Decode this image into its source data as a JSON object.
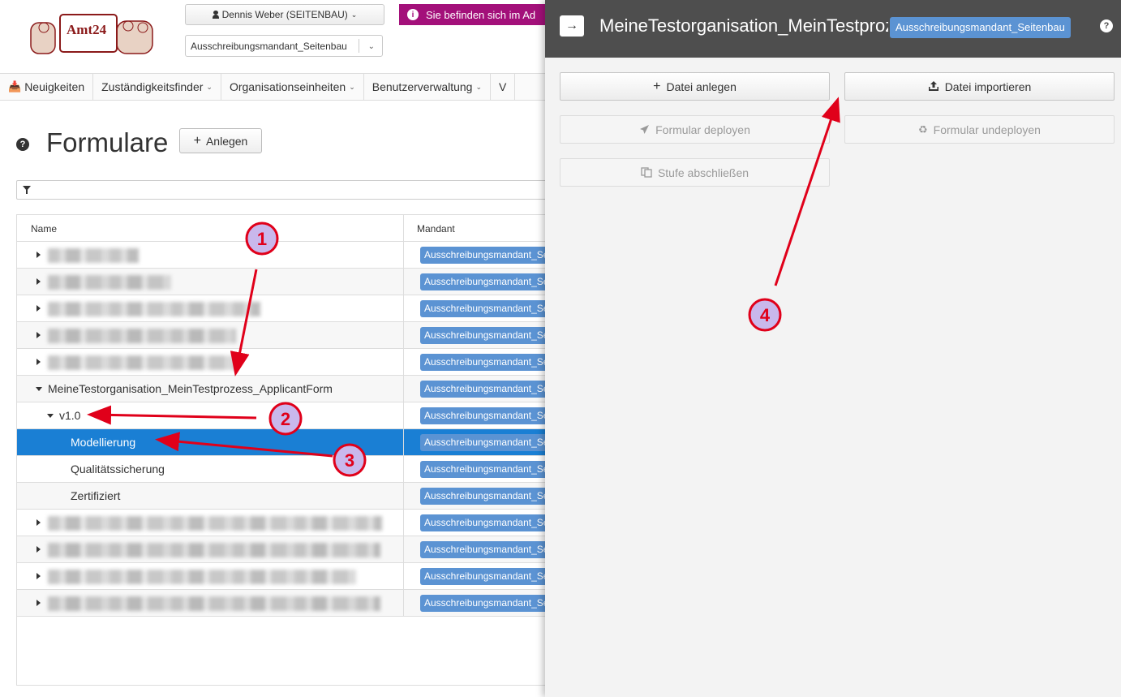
{
  "header": {
    "logo_text": "Amt24",
    "user_button": "Dennis Weber (SEITENBAU)",
    "mandant_select": "Ausschreibungsmandant_Seitenbau",
    "alert_text": "Sie befinden sich im Ad"
  },
  "nav": {
    "items": [
      {
        "label": "Neuigkeiten",
        "icon": "inbox-download-icon"
      },
      {
        "label": "Zuständigkeitsfinder",
        "has_caret": true
      },
      {
        "label": "Organisationseinheiten",
        "has_caret": true
      },
      {
        "label": "Benutzerverwaltung",
        "has_caret": true
      },
      {
        "label": "V"
      }
    ]
  },
  "page": {
    "title": "Formulare",
    "add_button": "Anlegen"
  },
  "table": {
    "columns": {
      "name": "Name",
      "mandant": "Mandant"
    },
    "badge_text": "Ausschreibungsmandant_Seitenbau",
    "rows": [
      {
        "label": "",
        "blurred": true
      },
      {
        "label": "",
        "blurred": true
      },
      {
        "label": "",
        "blurred": true
      },
      {
        "label": "",
        "blurred": true
      },
      {
        "label": "",
        "blurred": true
      },
      {
        "label": "MeineTestorganisation_MeinTestprozess_ApplicantForm",
        "expanded": true
      },
      {
        "label": "v1.0",
        "expanded": true
      },
      {
        "label": "Modellierung",
        "selected": true
      },
      {
        "label": "Qualitätssicherung"
      },
      {
        "label": "Zertifiziert"
      },
      {
        "label": "",
        "blurred": true
      },
      {
        "label": "",
        "blurred": true
      },
      {
        "label": "",
        "blurred": true
      },
      {
        "label": "",
        "blurred": true
      }
    ]
  },
  "panel": {
    "close_icon": "arrow-right-icon",
    "title": "MeineTestorganisation_MeinTestprozess_ApplicantForm",
    "badge": "Ausschreibungsmandant_Seitenbau",
    "buttons": {
      "create_file": "Datei anlegen",
      "import_file": "Datei importieren",
      "deploy": "Formular deployen",
      "undeploy": "Formular undeployen",
      "finish_stage": "Stufe abschließen"
    }
  },
  "annotations": [
    "1",
    "2",
    "3",
    "4"
  ],
  "colors": {
    "selected_row": "#1a7fd4",
    "badge": "#5b93d3",
    "alert": "#a3107a",
    "panel_header": "#4e4e4e",
    "annotation": "#e0001a",
    "annotation_fill": "#c9b8ec"
  }
}
